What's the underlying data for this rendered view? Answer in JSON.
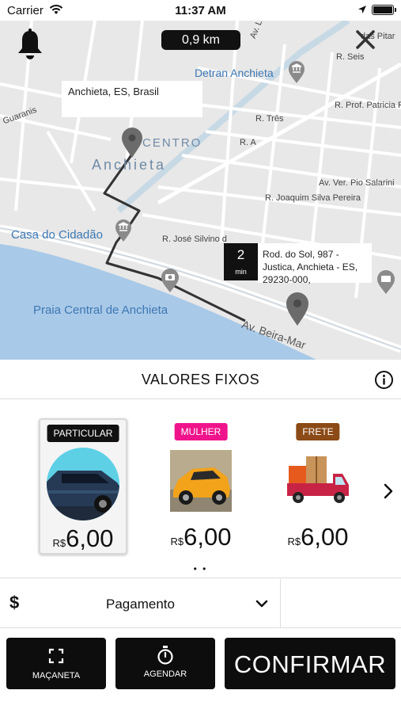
{
  "status_bar": {
    "carrier": "Carrier",
    "time": "11:37 AM"
  },
  "map": {
    "distance": "0,9 km",
    "origin_label": "Anchieta, ES, Brasil",
    "destination_label": "Rod. do Sol, 987 - Justica, Anchieta - ES, 29230-000,",
    "eta_value": "2",
    "eta_unit": "min",
    "labels": {
      "centro": "CENTRO",
      "anchieta": "Anchieta",
      "detran": "Detran Anchieta",
      "casa": "Casa do Cidadão",
      "praia": "Praia Central de Anchieta",
      "beira_mar": "Av. Beira-Mar",
      "r_seis": "R. Seis",
      "r_prof": "R. Prof. Patricia Ro",
      "r_tres": "R. Três",
      "r_a": "R. A",
      "av_pio": "Av. Ver. Pio Salarini",
      "r_joaquim": "R. Joaquim Silva Pereira",
      "r_jose": "R. José Silvino d",
      "guaranis": "Guaranis",
      "av_lest": "Av. Lest",
      "das_pitar": "das Pitar"
    }
  },
  "values_section": {
    "title": "VALORES FIXOS"
  },
  "options": [
    {
      "badge": "PARTICULAR",
      "badge_color": "#111111",
      "currency": "R$",
      "price": "6,00",
      "selected": true
    },
    {
      "badge": "MULHER",
      "badge_color": "#f0148c",
      "currency": "R$",
      "price": "6,00",
      "selected": false
    },
    {
      "badge": "FRETE",
      "badge_color": "#8b4a16",
      "currency": "R$",
      "price": "6,00",
      "selected": false
    }
  ],
  "pagination": "• •",
  "payment": {
    "currency_symbol": "$",
    "label": "Pagamento"
  },
  "buttons": {
    "macaneta": "MAÇANETA",
    "agendar": "AGENDAR",
    "confirmar": "CONFIRMAR"
  },
  "colors": {
    "water": "#a9c9e8",
    "route": "#333333",
    "pin": "#6b6b6b"
  }
}
